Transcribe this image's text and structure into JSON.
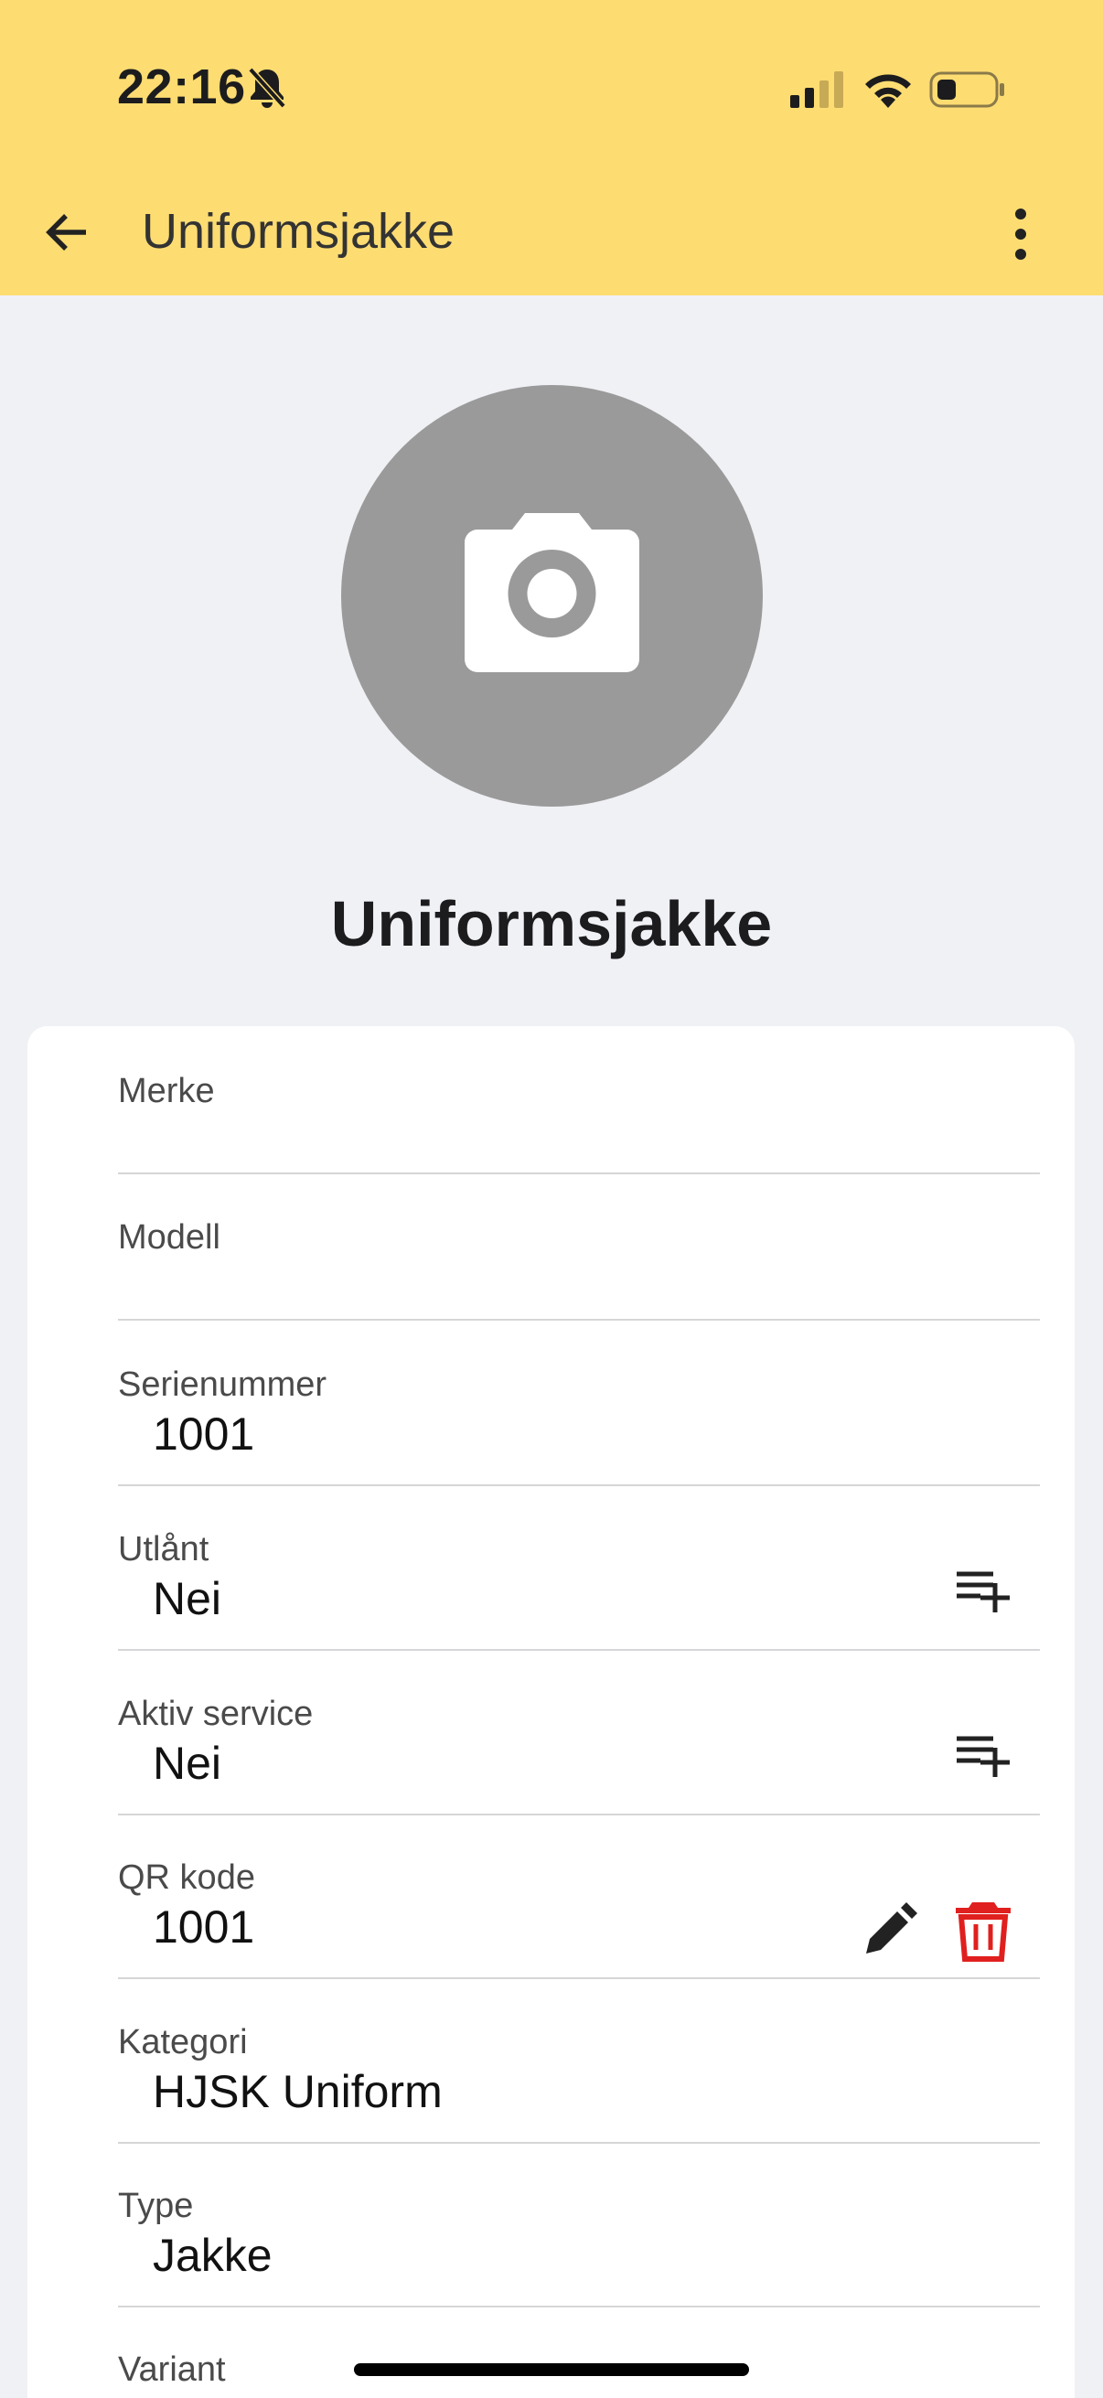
{
  "status": {
    "time": "22:16"
  },
  "appbar": {
    "title": "Uniformsjakke"
  },
  "item": {
    "name": "Uniformsjakke"
  },
  "fields": [
    {
      "label": "Merke",
      "value": ""
    },
    {
      "label": "Modell",
      "value": ""
    },
    {
      "label": "Serienummer",
      "value": "1001"
    },
    {
      "label": "Utlånt",
      "value": "Nei"
    },
    {
      "label": "Aktiv service",
      "value": "Nei"
    },
    {
      "label": "QR kode",
      "value": "1001"
    },
    {
      "label": "Kategori",
      "value": "HJSK Uniform"
    },
    {
      "label": "Type",
      "value": "Jakke"
    },
    {
      "label": "Variant",
      "value": ""
    }
  ],
  "icons": {
    "back": "arrow-left-icon",
    "more": "more-vertical-icon",
    "camera": "camera-icon",
    "add_list": "playlist-add-icon",
    "edit": "pencil-icon",
    "delete": "trash-icon"
  },
  "colors": {
    "appbar": "#fddc72",
    "delete": "#e0201e",
    "avatar": "#9a9a9a"
  }
}
